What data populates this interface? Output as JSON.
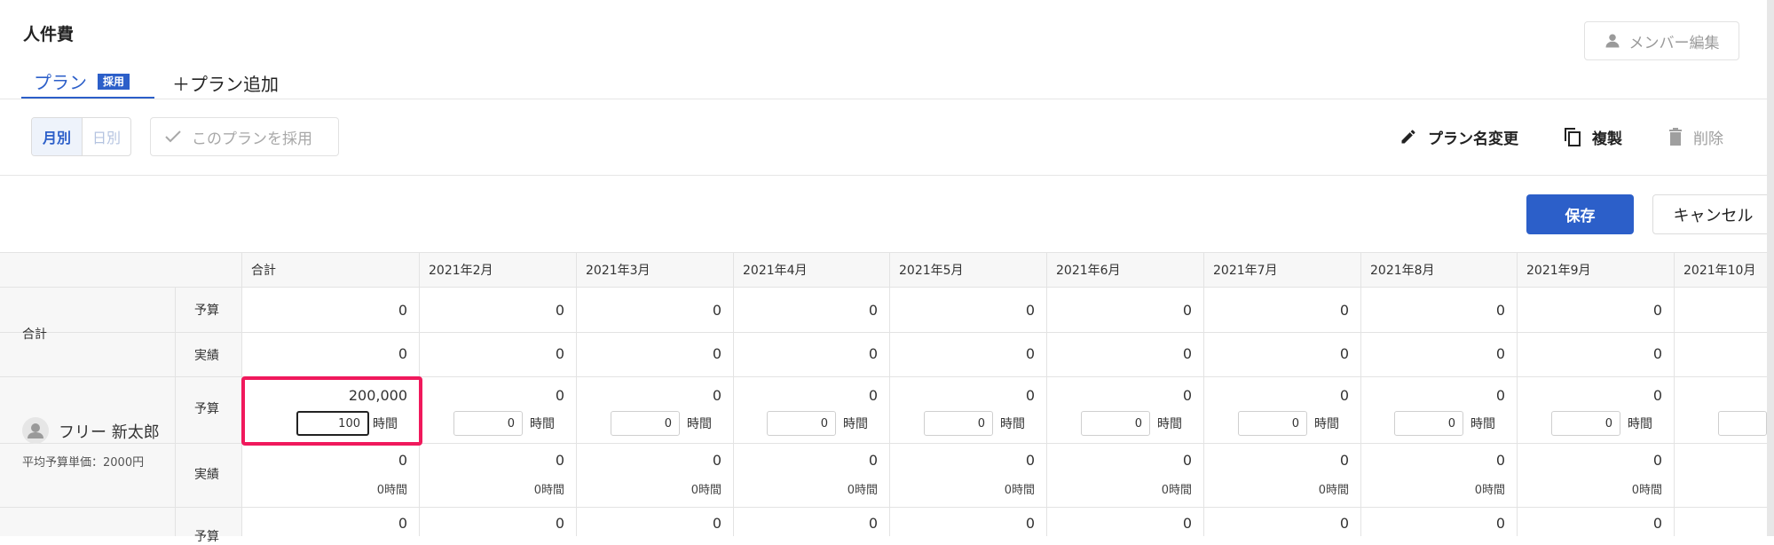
{
  "header": {
    "title": "人件費",
    "member_edit_label": "メンバー編集"
  },
  "tabs": {
    "plan_label": "プラン",
    "plan_badge": "採用",
    "add_plan_label": "＋プラン追加"
  },
  "toolbar": {
    "monthly_label": "月別",
    "daily_label": "日別",
    "adopt_label": "このプランを採用",
    "rename_label": "プラン名変更",
    "duplicate_label": "複製",
    "delete_label": "削除"
  },
  "actions": {
    "save_label": "保存",
    "cancel_label": "キャンセル"
  },
  "table": {
    "columns": [
      "合計",
      "2021年2月",
      "2021年3月",
      "2021年4月",
      "2021年5月",
      "2021年6月",
      "2021年7月",
      "2021年8月",
      "2021年9月",
      "2021年10月"
    ],
    "total_label": "合計",
    "budget_label": "予算",
    "actual_label": "実績",
    "hour_unit": "時間",
    "total_budget": [
      "0",
      "0",
      "0",
      "0",
      "0",
      "0",
      "0",
      "0",
      "0"
    ],
    "total_actual": [
      "0",
      "0",
      "0",
      "0",
      "0",
      "0",
      "0",
      "0",
      "0"
    ],
    "member": {
      "name": "フリー 新太郎",
      "avg_rate": "平均予算単価：2000円",
      "budget_values": [
        "200,000",
        "0",
        "0",
        "0",
        "0",
        "0",
        "0",
        "0",
        "0"
      ],
      "hour_inputs": [
        "100",
        "0",
        "0",
        "0",
        "0",
        "0",
        "0",
        "0",
        "0"
      ],
      "actual_values": [
        "0",
        "0",
        "0",
        "0",
        "0",
        "0",
        "0",
        "0",
        "0"
      ],
      "actual_hours": [
        "0時間",
        "0時間",
        "0時間",
        "0時間",
        "0時間",
        "0時間",
        "0時間",
        "0時間",
        "0時間"
      ]
    },
    "next_row_label": "予算",
    "next_row_values": [
      "0",
      "0",
      "0",
      "0",
      "0",
      "0",
      "0",
      "0",
      "0"
    ]
  },
  "colors": {
    "accent": "#2c5fc9",
    "highlight": "#f0195c"
  }
}
